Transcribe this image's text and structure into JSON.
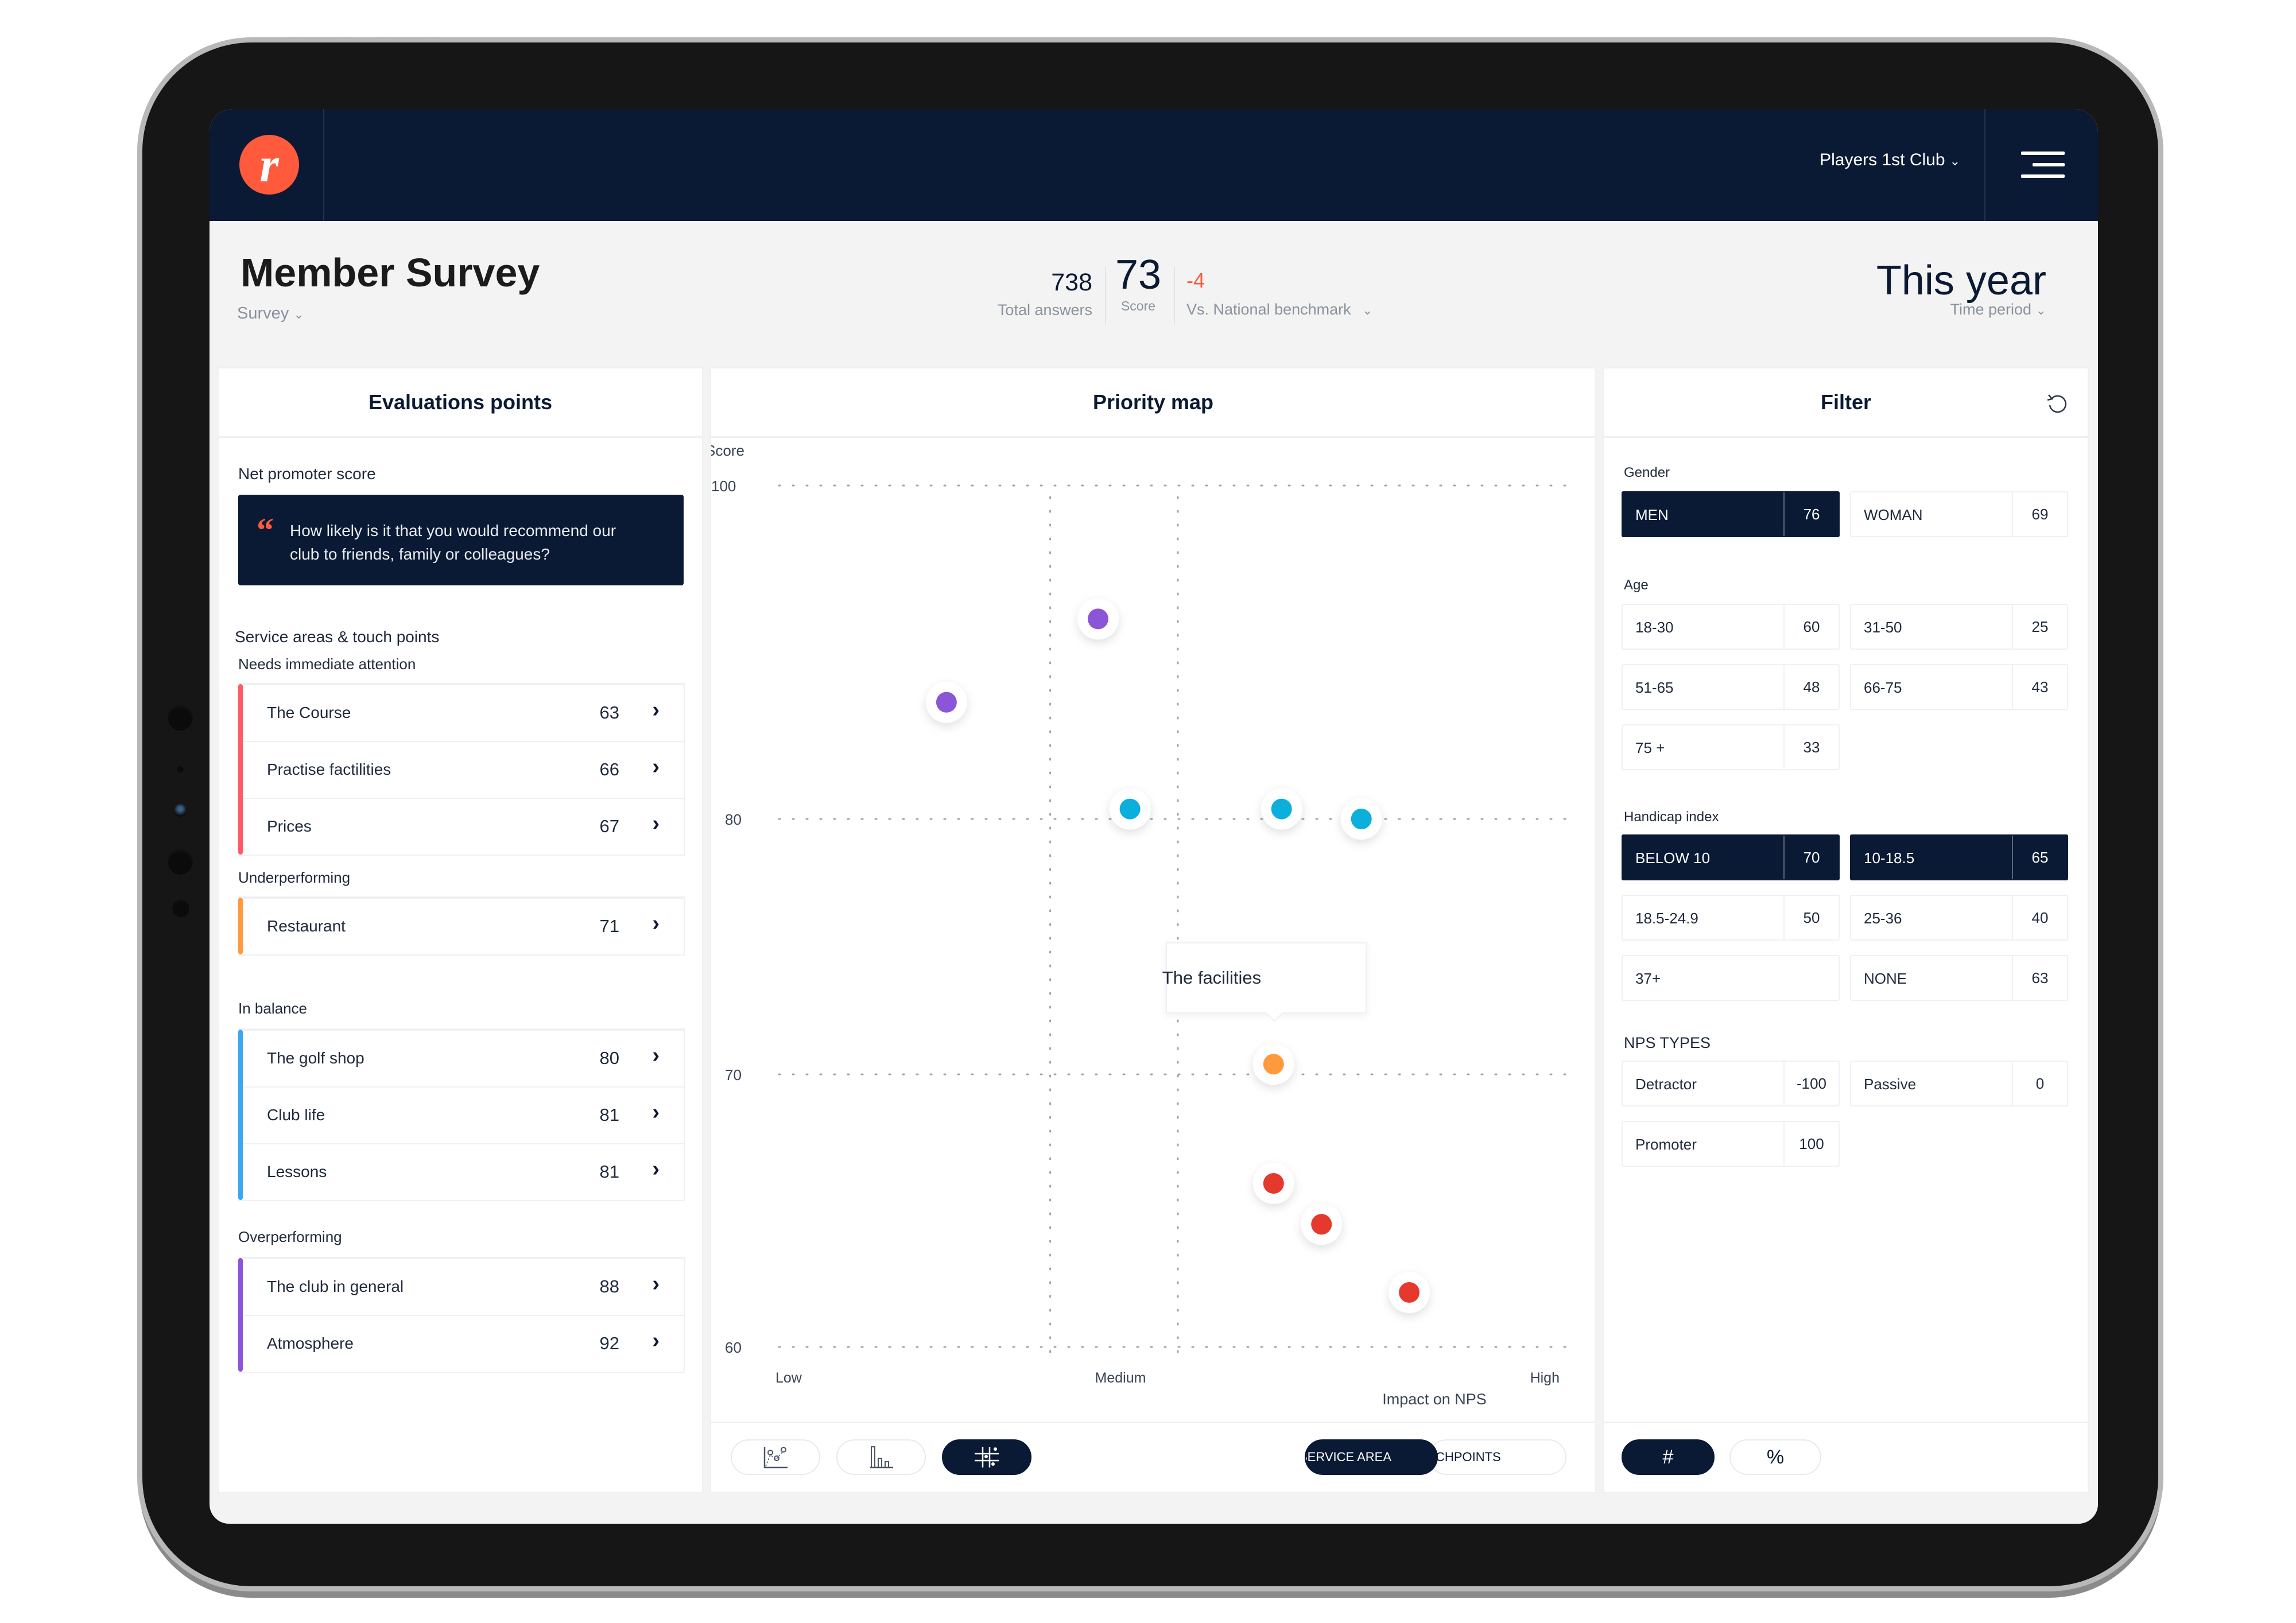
{
  "app": {
    "brand_color": "#ff5a3c",
    "nav_color": "#0a1a35",
    "logo_letter": "r",
    "club_selector": "Players 1st Club",
    "chevron": "⌄"
  },
  "header": {
    "title": "Member Survey",
    "survey_dropdown": "Survey",
    "kpis": {
      "total_answers": {
        "value": "738",
        "label": "Total answers"
      },
      "score": {
        "value": "73",
        "label": "Score"
      },
      "benchmark": {
        "value": "-4",
        "label": "Vs. National benchmark",
        "color": "#ff5a3c"
      }
    },
    "time_period": {
      "value": "This year",
      "label": "Time period"
    }
  },
  "evaluations": {
    "title": "Evaluations points",
    "nps_label": "Net promoter score",
    "nps_question": "How likely is it that you would recommend our club to friends, family or colleagues?",
    "quote_mark": "“",
    "service_areas_label": "Service areas & touch points",
    "groups": [
      {
        "label": "Needs immediate attention",
        "color": "#ff5a66",
        "items": [
          {
            "name": "The Course",
            "score": "63"
          },
          {
            "name": "Practise factilities",
            "score": "66"
          },
          {
            "name": "Prices",
            "score": "67"
          }
        ]
      },
      {
        "label": "Underperforming",
        "color": "#ff9a3c",
        "items": [
          {
            "name": "Restaurant",
            "score": "71"
          }
        ]
      },
      {
        "label": "In balance",
        "color": "#3aa8ee",
        "items": [
          {
            "name": "The golf shop",
            "score": "80"
          },
          {
            "name": "Club life",
            "score": "81"
          },
          {
            "name": "Lessons",
            "score": "81"
          }
        ]
      },
      {
        "label": "Overperforming",
        "color": "#8a55d6",
        "items": [
          {
            "name": "The club in general",
            "score": "88"
          },
          {
            "name": "Atmosphere",
            "score": "92"
          }
        ]
      }
    ],
    "row_chevron": "›"
  },
  "priority_map": {
    "title": "Priority map",
    "tooltip": "The facilities",
    "toolbar": {
      "view_buttons": [
        {
          "icon": "scatter-chart-icon",
          "active": false
        },
        {
          "icon": "bar-chart-icon",
          "active": false
        },
        {
          "icon": "priority-grid-icon",
          "active": true
        }
      ],
      "segment": [
        {
          "label": "SERVICE AREA",
          "active": true
        },
        {
          "label": "TOUCHPOINTS",
          "active": false
        }
      ]
    }
  },
  "chart_data": {
    "type": "scatter",
    "title": "Priority map",
    "ylabel": "Score",
    "xlabel": "Impact on NPS",
    "y_ticks": [
      100,
      80,
      70,
      60
    ],
    "ylim": [
      60,
      100
    ],
    "x_tick_labels": [
      "Low",
      "Medium",
      "High"
    ],
    "xlim": [
      0,
      100
    ],
    "x_dividers": [
      34,
      50
    ],
    "grid": "dotted",
    "points": [
      {
        "label": "Atmosphere",
        "x": 40,
        "y": 92,
        "color": "#8a55d6"
      },
      {
        "label": "The club in general",
        "x": 21,
        "y": 87,
        "color": "#8a55d6"
      },
      {
        "label": "The golf shop",
        "x": 44,
        "y": 80.6,
        "color": "#0aafdc"
      },
      {
        "label": "Club life",
        "x": 63,
        "y": 80.6,
        "color": "#0aafdc"
      },
      {
        "label": "Lessons",
        "x": 73,
        "y": 80,
        "color": "#0aafdc"
      },
      {
        "label": "The facilities",
        "x": 62,
        "y": 70.4,
        "color": "#ff9a3c",
        "tooltip": true
      },
      {
        "label": "Prices",
        "x": 62,
        "y": 66,
        "color": "#e6392d"
      },
      {
        "label": "Practise factilities",
        "x": 68,
        "y": 64.5,
        "color": "#e6392d"
      },
      {
        "label": "The Course",
        "x": 79,
        "y": 62,
        "color": "#e6392d"
      }
    ]
  },
  "filter": {
    "title": "Filter",
    "sections": [
      {
        "label": "Gender",
        "chips": [
          {
            "name": "MEN",
            "value": "76",
            "active": true
          },
          {
            "name": "WOMAN",
            "value": "69",
            "active": false
          }
        ]
      },
      {
        "label": "Age",
        "chips": [
          {
            "name": "18-30",
            "value": "60",
            "active": false
          },
          {
            "name": "31-50",
            "value": "25",
            "active": false
          },
          {
            "name": "51-65",
            "value": "48",
            "active": false
          },
          {
            "name": "66-75",
            "value": "43",
            "active": false
          },
          {
            "name": "75 +",
            "value": "33",
            "active": false
          }
        ]
      },
      {
        "label": "Handicap index",
        "chips": [
          {
            "name": "BELOW 10",
            "value": "70",
            "active": true
          },
          {
            "name": "10-18.5",
            "value": "65",
            "active": true
          },
          {
            "name": "18.5-24.9",
            "value": "50",
            "active": false
          },
          {
            "name": "25-36",
            "value": "40",
            "active": false
          },
          {
            "name": "37+",
            "value": "",
            "active": false
          },
          {
            "name": "NONE",
            "value": "63",
            "active": false
          }
        ]
      },
      {
        "label": "NPS TYPES",
        "chips": [
          {
            "name": "Detractor",
            "value": "-100",
            "active": false
          },
          {
            "name": "Passive",
            "value": "0",
            "active": false
          },
          {
            "name": "Promoter",
            "value": "100",
            "active": false
          }
        ]
      }
    ],
    "units": [
      {
        "label": "#",
        "active": true
      },
      {
        "label": "%",
        "active": false
      }
    ]
  }
}
